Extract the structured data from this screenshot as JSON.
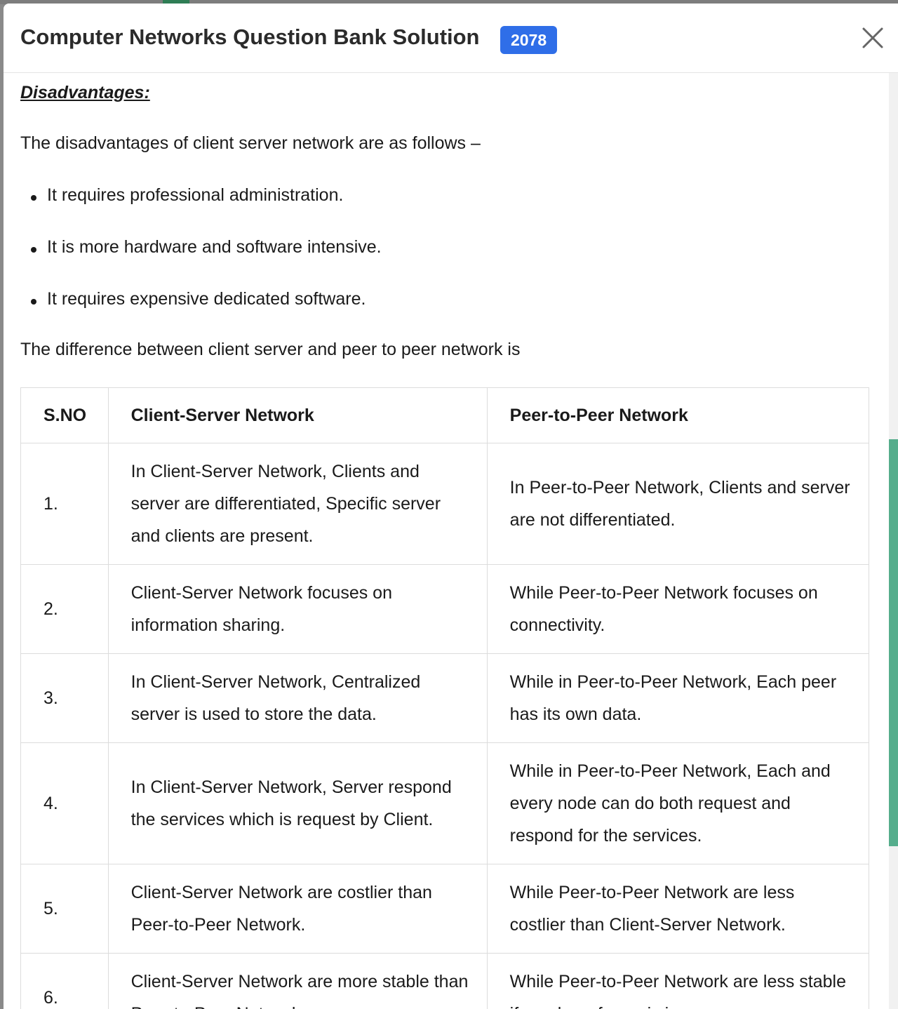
{
  "modal": {
    "title": "Computer Networks Question Bank Solution",
    "year_badge": "2078",
    "accent_color": "#2f6ee8",
    "scrollbar_color": "#55ad8c"
  },
  "content": {
    "heading": "Disadvantages:",
    "intro": "The disadvantages of client server network are as follows –",
    "bullets": [
      "It requires professional administration.",
      "It is more hardware and software intensive.",
      "It requires expensive dedicated software."
    ],
    "difference_intro": "The difference between client server and peer to peer network is"
  },
  "table": {
    "headers": [
      "S.NO",
      "Client-Server Network",
      "Peer-to-Peer Network"
    ],
    "rows": [
      [
        "1.",
        "In Client-Server Network, Clients and server are differentiated, Specific server and clients are present.",
        "In Peer-to-Peer Network, Clients and server are not differentiated."
      ],
      [
        "2.",
        "Client-Server Network focuses on information sharing.",
        "While Peer-to-Peer Network focuses on connectivity."
      ],
      [
        "3.",
        "In Client-Server Network, Centralized server is used to store the data.",
        "While in Peer-to-Peer Network, Each peer has its own data."
      ],
      [
        "4.",
        "In Client-Server Network, Server respond the services which is request by Client.",
        "While in Peer-to-Peer Network, Each and every node can do both request and respond for the services."
      ],
      [
        "5.",
        "Client-Server Network are costlier than Peer-to-Peer Network.",
        "While Peer-to-Peer Network are less costlier than Client-Server Network."
      ],
      [
        "6.",
        "Client-Server Network are more stable than Peer-to-Peer Network.",
        "While Peer-to-Peer Network are less stable if number of peer is increase."
      ]
    ]
  }
}
